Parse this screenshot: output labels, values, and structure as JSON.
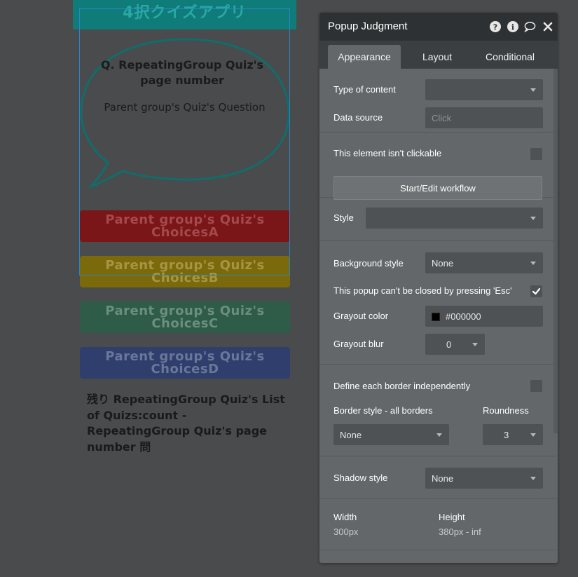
{
  "canvas": {
    "header_title": "4択クイズアプリ",
    "question_title": "Q. RepeatingGroup Quiz's page number",
    "question_text": "Parent group's Quiz's Question",
    "choices": [
      {
        "label": "Parent group's Quiz's ChoicesA",
        "color": "#7a1518"
      },
      {
        "label": "Parent group's Quiz's ChoicesB",
        "color": "#7a6a0c"
      },
      {
        "label": "Parent group's Quiz's ChoicesC",
        "color": "#2e5c48"
      },
      {
        "label": "Parent group's Quiz's ChoicesD",
        "color": "#2f3e6c"
      }
    ],
    "remaining_text": "残り RepeatingGroup Quiz's List of Quizs:count - RepeatingGroup Quiz's page number 問"
  },
  "panel": {
    "title": "Popup Judgment",
    "header_icons": [
      "help-icon",
      "info-icon",
      "comment-icon",
      "close-icon"
    ],
    "tabs": [
      {
        "label": "Appearance",
        "active": true
      },
      {
        "label": "Layout",
        "active": false
      },
      {
        "label": "Conditional",
        "active": false
      }
    ],
    "type_of_content": {
      "label": "Type of content",
      "value": ""
    },
    "data_source": {
      "label": "Data source",
      "placeholder": "Click"
    },
    "not_clickable": {
      "label": "This element isn't clickable",
      "checked": false
    },
    "workflow_button": "Start/Edit workflow",
    "style": {
      "label": "Style",
      "value": ""
    },
    "background_style": {
      "label": "Background style",
      "value": "None"
    },
    "esc_close": {
      "label": "This popup can't be closed by pressing 'Esc'",
      "checked": true
    },
    "grayout_color": {
      "label": "Grayout color",
      "value": "#000000"
    },
    "grayout_blur": {
      "label": "Grayout blur",
      "value": "0"
    },
    "border_independent": {
      "label": "Define each border independently",
      "checked": false
    },
    "border_style": {
      "label": "Border style - all borders",
      "value": "None"
    },
    "roundness": {
      "label": "Roundness",
      "value": "3"
    },
    "shadow_style": {
      "label": "Shadow style",
      "value": "None"
    },
    "width": {
      "label": "Width",
      "value": "300px"
    },
    "height": {
      "label": "Height",
      "value": "380px - inf"
    }
  }
}
